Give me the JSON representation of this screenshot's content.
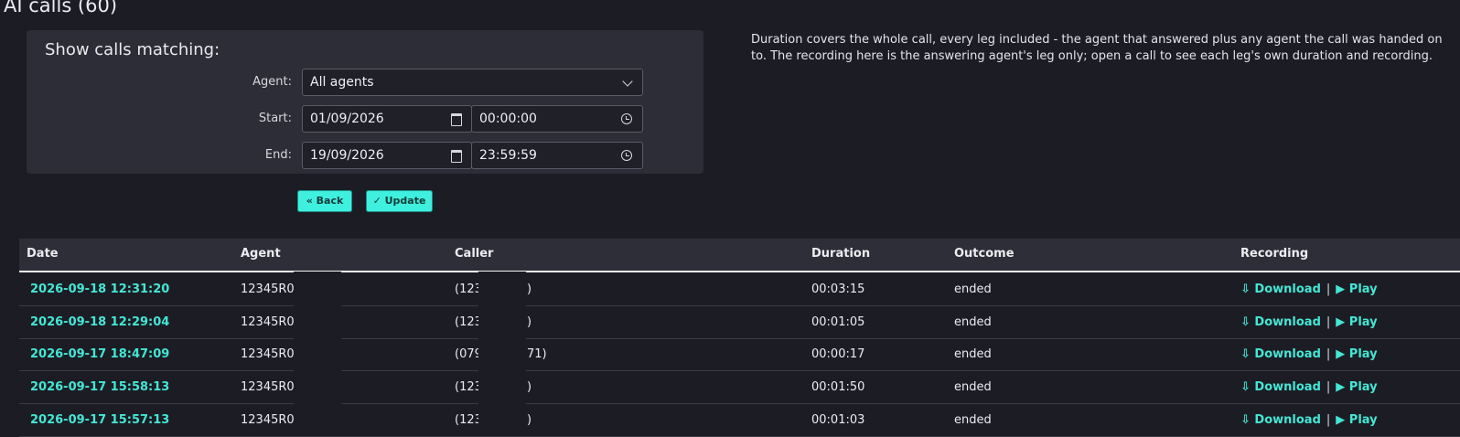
{
  "page": {
    "title": "AI calls (60)"
  },
  "filter": {
    "heading": "Show calls matching:",
    "agent_label": "Agent:",
    "agent_value": "All agents",
    "start_label": "Start:",
    "start_date": "01/09/2026",
    "start_time": "00:00:00",
    "end_label": "End:",
    "end_date": "19/09/2026",
    "end_time": "23:59:59"
  },
  "buttons": {
    "back": "« Back",
    "update": "✓ Update"
  },
  "help_text": "Duration covers the whole call, every leg included - the agent that answered plus any agent the call was handed on to. The recording here is the answering agent's leg only; open a call to see each leg's own duration and recording.",
  "table": {
    "headers": [
      "Date",
      "Agent",
      "Caller",
      "Duration",
      "Outcome",
      "Recording"
    ],
    "download_label": "⇩ Download",
    "separator": "|",
    "play_label": "▶ Play",
    "rows": [
      {
        "date": "2026-09-18 12:31:20",
        "agent": "12345R0",
        "caller_start": "(123",
        "caller_end": ")",
        "duration": "00:03:15",
        "outcome": "ended"
      },
      {
        "date": "2026-09-18 12:29:04",
        "agent": "12345R0",
        "caller_start": "(123",
        "caller_end": ")",
        "duration": "00:01:05",
        "outcome": "ended"
      },
      {
        "date": "2026-09-17 18:47:09",
        "agent": "12345R0",
        "caller_start": "(079",
        "caller_end": "71)",
        "duration": "00:00:17",
        "outcome": "ended"
      },
      {
        "date": "2026-09-17 15:58:13",
        "agent": "12345R0",
        "caller_start": "(123",
        "caller_end": ")",
        "duration": "00:01:50",
        "outcome": "ended"
      },
      {
        "date": "2026-09-17 15:57:13",
        "agent": "12345R0",
        "caller_start": "(123",
        "caller_end": ")",
        "duration": "00:01:03",
        "outcome": "ended"
      }
    ]
  }
}
